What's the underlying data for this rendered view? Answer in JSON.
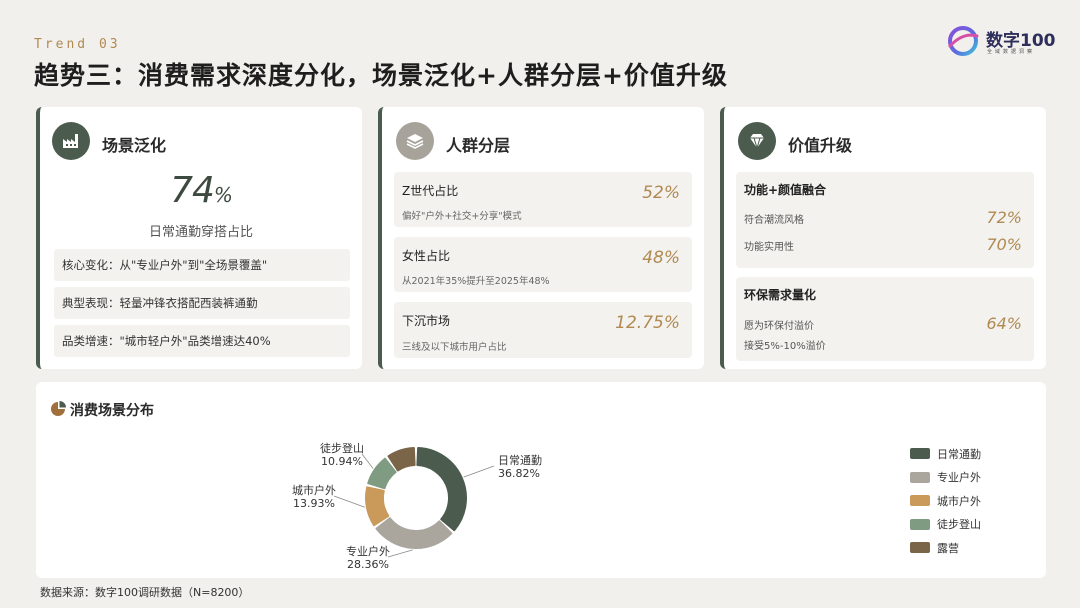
{
  "header": {
    "trend": "Trend 03",
    "title": "趋势三：消费需求深度分化，场景泛化+人群分层+价值升级"
  },
  "logo": {
    "name": "数字100",
    "sub": "全域数据洞察"
  },
  "card_scene": {
    "title": "场景泛化",
    "big_value": "74",
    "big_unit": "%",
    "big_desc": "日常通勤穿搭占比",
    "rows": [
      "核心变化：从\"专业户外\"到\"全场景覆盖\"",
      "典型表现：轻量冲锋衣搭配西装裤通勤",
      "品类增速：\"城市轻户外\"品类增速达40%"
    ]
  },
  "card_people": {
    "title": "人群分层",
    "stats": [
      {
        "label": "Z世代占比",
        "sub": "偏好\"户外+社交+分享\"模式",
        "value": "52%"
      },
      {
        "label": "女性占比",
        "sub": "从2021年35%提升至2025年48%",
        "value": "48%"
      },
      {
        "label": "下沉市场",
        "sub": "三线及以下城市用户占比",
        "value": "12.75%"
      }
    ]
  },
  "card_value": {
    "title": "价值升级",
    "box1": {
      "title": "功能+颜值融合",
      "rows": [
        {
          "label": "符合潮流风格",
          "value": "72%"
        },
        {
          "label": "功能实用性",
          "value": "70%"
        }
      ]
    },
    "box2": {
      "title": "环保需求量化",
      "rows": [
        {
          "label": "愿为环保付溢价",
          "value": "64%"
        },
        {
          "label": "接受5%-10%溢价",
          "value": ""
        }
      ]
    }
  },
  "chart_section": {
    "title": "消费场景分布"
  },
  "chart_data": {
    "type": "pie",
    "title": "消费场景分布",
    "labels": [
      "日常通勤",
      "专业户外",
      "城市户外",
      "徒步登山",
      "露营"
    ],
    "values": [
      36.82,
      28.36,
      13.93,
      10.94,
      9.95
    ],
    "value_labels": [
      "36.82%",
      "28.36%",
      "13.93%",
      "10.94%",
      ""
    ],
    "colors": [
      "#4b5c4f",
      "#aaa69e",
      "#c99a5a",
      "#7f9b82",
      "#7a6548"
    ],
    "donut": true,
    "legend_position": "right"
  },
  "footer": {
    "source": "数据来源：数字100调研数据（N=8200）"
  }
}
